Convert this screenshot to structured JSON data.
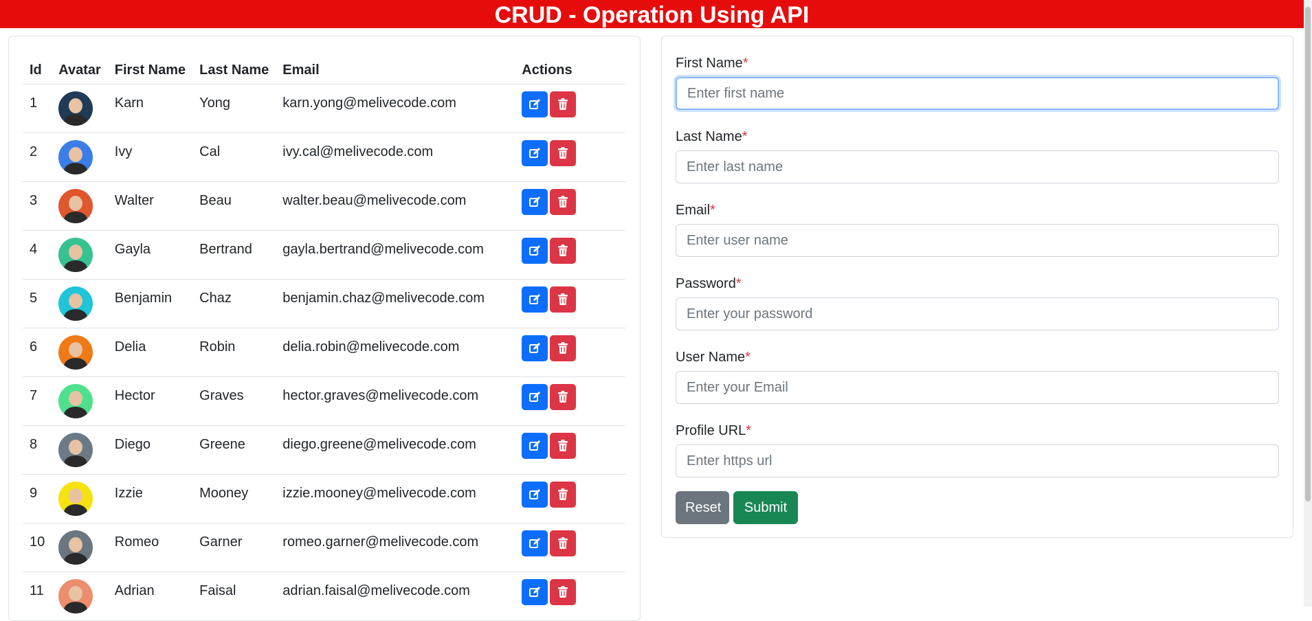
{
  "header": {
    "title": "CRUD - Operation Using API"
  },
  "table": {
    "columns": [
      "Id",
      "Avatar",
      "First Name",
      "Last Name",
      "Email",
      "Actions"
    ],
    "rows": [
      {
        "id": "1",
        "first": "Karn",
        "last": "Yong",
        "email": "karn.yong@melivecode.com",
        "avatar_color": "#1f3b57"
      },
      {
        "id": "2",
        "first": "Ivy",
        "last": "Cal",
        "email": "ivy.cal@melivecode.com",
        "avatar_color": "#3b7de9"
      },
      {
        "id": "3",
        "first": "Walter",
        "last": "Beau",
        "email": "walter.beau@melivecode.com",
        "avatar_color": "#e0562d"
      },
      {
        "id": "4",
        "first": "Gayla",
        "last": "Bertrand",
        "email": "gayla.bertrand@melivecode.com",
        "avatar_color": "#36c290"
      },
      {
        "id": "5",
        "first": "Benjamin",
        "last": "Chaz",
        "email": "benjamin.chaz@melivecode.com",
        "avatar_color": "#1fc5d9"
      },
      {
        "id": "6",
        "first": "Delia",
        "last": "Robin",
        "email": "delia.robin@melivecode.com",
        "avatar_color": "#f07a16"
      },
      {
        "id": "7",
        "first": "Hector",
        "last": "Graves",
        "email": "hector.graves@melivecode.com",
        "avatar_color": "#4fe08e"
      },
      {
        "id": "8",
        "first": "Diego",
        "last": "Greene",
        "email": "diego.greene@melivecode.com",
        "avatar_color": "#6a7a87"
      },
      {
        "id": "9",
        "first": "Izzie",
        "last": "Mooney",
        "email": "izzie.mooney@melivecode.com",
        "avatar_color": "#f5e20f"
      },
      {
        "id": "10",
        "first": "Romeo",
        "last": "Garner",
        "email": "romeo.garner@melivecode.com",
        "avatar_color": "#6a7680"
      },
      {
        "id": "11",
        "first": "Adrian",
        "last": "Faisal",
        "email": "adrian.faisal@melivecode.com",
        "avatar_color": "#ec8d6e"
      }
    ],
    "edit_icon": "edit-icon",
    "delete_icon": "trash-icon"
  },
  "form": {
    "fields": [
      {
        "label": "First Name",
        "required": "*",
        "placeholder": "Enter first name"
      },
      {
        "label": "Last Name",
        "required": "*",
        "placeholder": "Enter last name"
      },
      {
        "label": "Email",
        "required": "*",
        "placeholder": "Enter user name"
      },
      {
        "label": "Password",
        "required": "*",
        "placeholder": "Enter your password"
      },
      {
        "label": "User Name",
        "required": "*",
        "placeholder": "Enter your Email"
      },
      {
        "label": "Profile URL",
        "required": "*",
        "placeholder": "Enter https url"
      }
    ],
    "reset_label": "Reset",
    "submit_label": "Submit"
  },
  "colors": {
    "header_bg": "#e60c0c",
    "edit_button": "#0d6efd",
    "delete_button": "#dc3545",
    "reset_button": "#6c757d",
    "submit_button": "#198754"
  }
}
